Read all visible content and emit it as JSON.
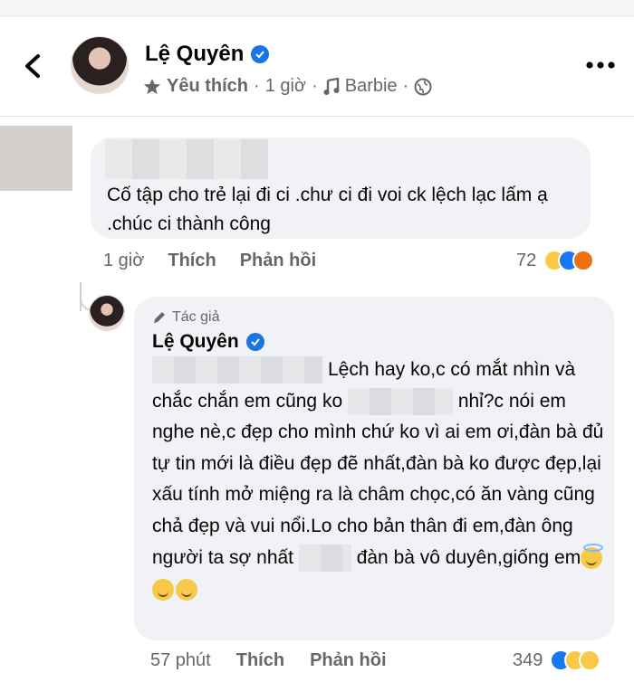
{
  "header": {
    "name": "Lệ Quyên",
    "follow_label": "Yêu thích",
    "time": "1 giờ",
    "audio": "Barbie",
    "sep1": "·",
    "sep2": "·"
  },
  "comment1": {
    "text": "Cố tập cho trẻ lại đi ci .chư ci đi voi ck lệch lạc lấm ạ .chúc ci thành công",
    "time": "1 giờ",
    "like": "Thích",
    "reply": "Phản hồi",
    "reaction_count": "72"
  },
  "comment2": {
    "author_tag": "Tác giả",
    "name": "Lệ Quyên",
    "text_parts": [
      "Lệch hay ko,c có mắt nhìn và chắc chắn em cũng ko",
      "nhỉ?c nói em nghe nè,c đẹp cho mình chứ ko vì ai em ơi,đàn bà đủ tự tin mới là điều đẹp đẽ nhất,đàn bà ko được đẹp,lại xấu tính mở miệng ra là châm chọc,có ăn vàng cũng chả đẹp và vui nổi.Lo cho bản thân đi em,đàn ông người ta sợ nhất",
      "đàn bà vô duyên,giống em"
    ],
    "time": "57 phút",
    "like": "Thích",
    "reply": "Phản hồi",
    "reaction_count": "349"
  },
  "icons": [
    "back-arrow-icon",
    "verified-badge-icon",
    "star-icon",
    "music-note-icon",
    "globe-icon",
    "more-options-icon",
    "pencil-icon",
    "haha-reaction-icon",
    "like-reaction-icon",
    "angry-reaction-icon",
    "halo-emoji-icon",
    "grin-emoji-icon",
    "hand-over-mouth-emoji-icon"
  ],
  "colors": {
    "accent": "#1b74e4",
    "bubble": "#f0f2f5",
    "muted": "#65676b"
  }
}
